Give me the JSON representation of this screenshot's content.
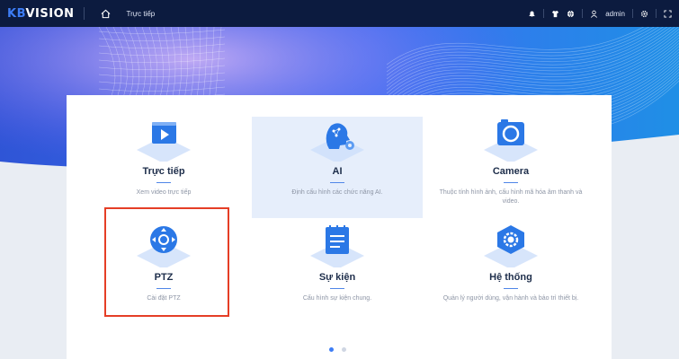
{
  "header": {
    "logo_kb": "KB",
    "logo_rest": "VISION",
    "nav_link": "Trực tiếp",
    "username": "admin"
  },
  "tiles": [
    {
      "title": "Trực tiếp",
      "desc": "Xem video trực tiếp",
      "icon": "monitor-play-icon"
    },
    {
      "title": "AI",
      "desc": "Định cấu hình các chức năng AI.",
      "icon": "ai-head-icon"
    },
    {
      "title": "Camera",
      "desc": "Thuộc tính hình ảnh, cấu hình mã hóa âm thanh và video.",
      "icon": "camera-icon"
    },
    {
      "title": "PTZ",
      "desc": "Cài đặt PTZ",
      "icon": "ptz-joystick-icon"
    },
    {
      "title": "Sự kiện",
      "desc": "Cấu hình sự kiện chung.",
      "icon": "event-notepad-icon"
    },
    {
      "title": "Hệ thống",
      "desc": "Quản lý người dùng, vận hành và bảo trì thiết bị.",
      "icon": "system-gear-icon"
    }
  ],
  "pager": {
    "pages": 2,
    "active": 1
  },
  "colors": {
    "topbar": "#0c1b3f",
    "accent": "#3d7df5",
    "highlight": "#e53e26"
  }
}
